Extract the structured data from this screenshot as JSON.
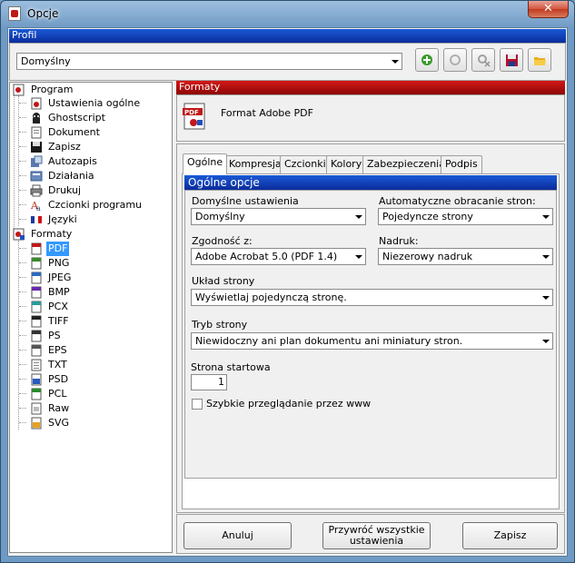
{
  "window": {
    "title": "Opcje",
    "close_glyph": "✕"
  },
  "profil": {
    "header": "Profil",
    "selected": "Domyślny",
    "toolbar_icons": [
      "add-profile-icon",
      "rename-profile-icon",
      "delete-profile-icon",
      "save-profile-icon",
      "open-profile-icon"
    ]
  },
  "tree": {
    "program_label": "Program",
    "program_items": [
      "Ustawienia ogólne",
      "Ghostscript",
      "Dokument",
      "Zapisz",
      "Autozapis",
      "Działania",
      "Drukuj",
      "Czcionki programu",
      "Języki"
    ],
    "formaty_label": "Formaty",
    "formaty_items": [
      "PDF",
      "PNG",
      "JPEG",
      "BMP",
      "PCX",
      "TIFF",
      "PS",
      "EPS",
      "TXT",
      "PSD",
      "PCL",
      "Raw",
      "SVG"
    ],
    "selected": "PDF"
  },
  "formaty": {
    "header": "Formaty",
    "title": "Format Adobe PDF"
  },
  "tabs": [
    "Ogólne",
    "Kompresja",
    "Czcionki",
    "Kolory",
    "Zabezpieczenia",
    "Podpis"
  ],
  "active_tab": "Ogólne",
  "general": {
    "header": "Ogólne opcje",
    "default_settings_label": "Domyślne ustawienia",
    "default_settings_value": "Domyślny",
    "auto_rotate_label": "Automatyczne obracanie stron:",
    "auto_rotate_value": "Pojedyncze strony",
    "compat_label": "Zgodność z:",
    "compat_value": "Adobe Acrobat 5.0 (PDF 1.4)",
    "overprint_label": "Nadruk:",
    "overprint_value": "Niezerowy nadruk",
    "page_layout_label": "Układ strony",
    "page_layout_value": "Wyświetlaj pojedynczą stronę.",
    "page_mode_label": "Tryb strony",
    "page_mode_value": "Niewidoczny ani plan dokumentu ani miniatury stron.",
    "start_page_label": "Strona startowa",
    "start_page_value": "1",
    "fast_web_label": "Szybkie przeglądanie przez www",
    "fast_web_checked": false
  },
  "buttons": {
    "cancel": "Anuluj",
    "restore_line1": "Przywróć wszystkie",
    "restore_line2": "ustawienia",
    "save": "Zapisz"
  },
  "colors": {
    "profil_bar": "#0a2c9c",
    "formaty_bar": "#8c0606",
    "selection": "#3399ff"
  }
}
